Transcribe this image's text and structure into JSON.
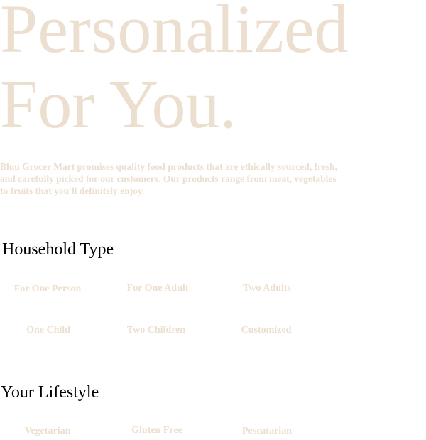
{
  "hero": {
    "line1": "Personalized",
    "line2": "For You."
  },
  "intro": "Bluu Grocer Mart promises quality food products that are ethically sourced, fresh, and carefully picked for our customers. Our products range from meat, vegetables to fruits that you'll definitely enjoy.",
  "household": {
    "heading": "Household Type",
    "options": [
      "For One Person",
      "For One Adult",
      "Two Adults",
      "One Child",
      "Two Children",
      "Customized"
    ]
  },
  "lifestyle": {
    "heading": "Your Lifestyle",
    "options": [
      "Vegetarian",
      "Gluten Free",
      "Pescatarian"
    ]
  },
  "colors": {
    "muted_text": "#ecdfd0",
    "heading_text": "#000000",
    "background": "#ffffff"
  }
}
